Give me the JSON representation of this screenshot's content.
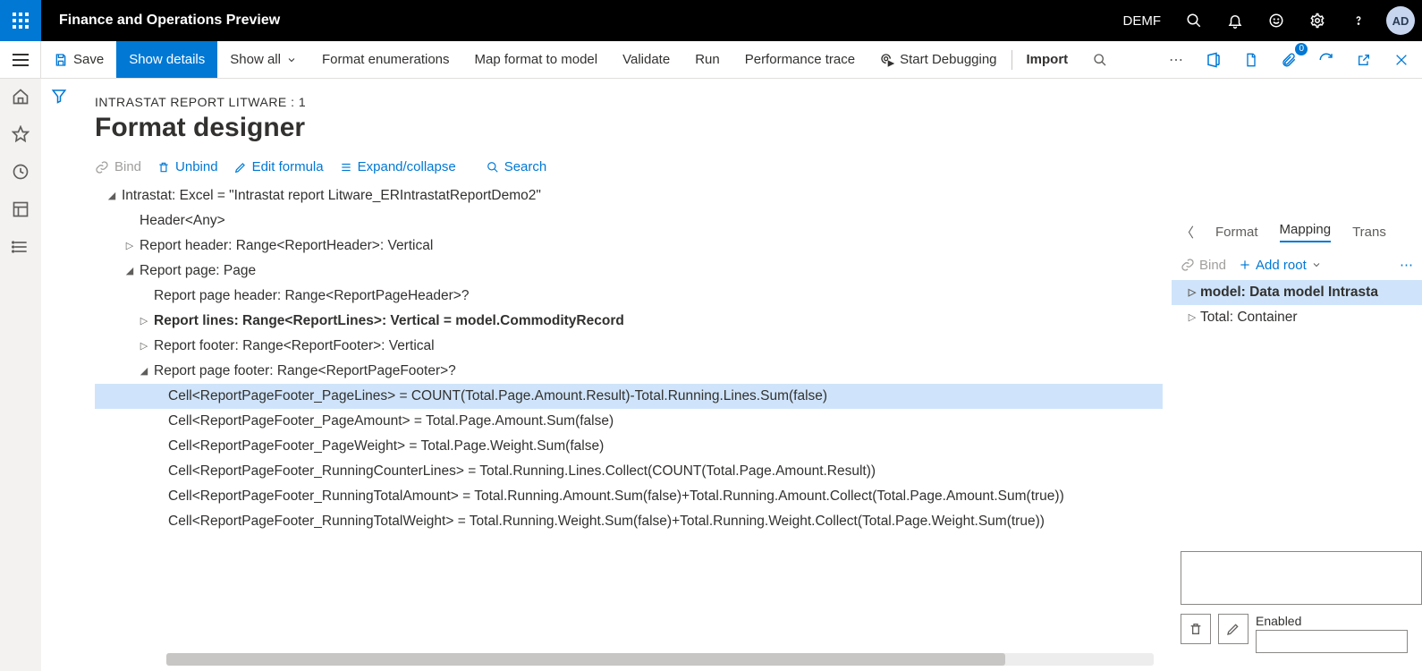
{
  "topbar": {
    "appTitle": "Finance and Operations Preview",
    "company": "DEMF",
    "avatar": "AD"
  },
  "cmdbar": {
    "save": "Save",
    "showDetails": "Show details",
    "showAll": "Show all",
    "formatEnum": "Format enumerations",
    "mapFormat": "Map format to model",
    "validate": "Validate",
    "run": "Run",
    "perfTrace": "Performance trace",
    "startDebug": "Start Debugging",
    "import": "Import",
    "badgeCount": "0"
  },
  "page": {
    "breadcrumb": "INTRASTAT REPORT LITWARE : 1",
    "title": "Format designer"
  },
  "formatBar": {
    "bind": "Bind",
    "unbind": "Unbind",
    "editFormula": "Edit formula",
    "expandCollapse": "Expand/collapse",
    "search": "Search"
  },
  "tree": {
    "n0": "Intrastat: Excel = \"Intrastat report Litware_ERIntrastatReportDemo2\"",
    "n1": "Header<Any>",
    "n2": "Report header: Range<ReportHeader>: Vertical",
    "n3": "Report page: Page",
    "n4": "Report page header: Range<ReportPageHeader>?",
    "n5": "Report lines: Range<ReportLines>: Vertical = model.CommodityRecord",
    "n6": "Report footer: Range<ReportFooter>: Vertical",
    "n7": "Report page footer: Range<ReportPageFooter>?",
    "n8": "Cell<ReportPageFooter_PageLines> = COUNT(Total.Page.Amount.Result)-Total.Running.Lines.Sum(false)",
    "n9": "Cell<ReportPageFooter_PageAmount> = Total.Page.Amount.Sum(false)",
    "n10": "Cell<ReportPageFooter_PageWeight> = Total.Page.Weight.Sum(false)",
    "n11": "Cell<ReportPageFooter_RunningCounterLines> = Total.Running.Lines.Collect(COUNT(Total.Page.Amount.Result))",
    "n12": "Cell<ReportPageFooter_RunningTotalAmount> = Total.Running.Amount.Sum(false)+Total.Running.Amount.Collect(Total.Page.Amount.Sum(true))",
    "n13": "Cell<ReportPageFooter_RunningTotalWeight> = Total.Running.Weight.Sum(false)+Total.Running.Weight.Collect(Total.Page.Weight.Sum(true))"
  },
  "rightTabs": {
    "format": "Format",
    "mapping": "Mapping",
    "trans": "Trans"
  },
  "mapBar": {
    "bind": "Bind",
    "addRoot": "Add root"
  },
  "mapTree": {
    "m0": "model: Data model Intrasta",
    "m1": "Total: Container"
  },
  "enabledLabel": "Enabled"
}
